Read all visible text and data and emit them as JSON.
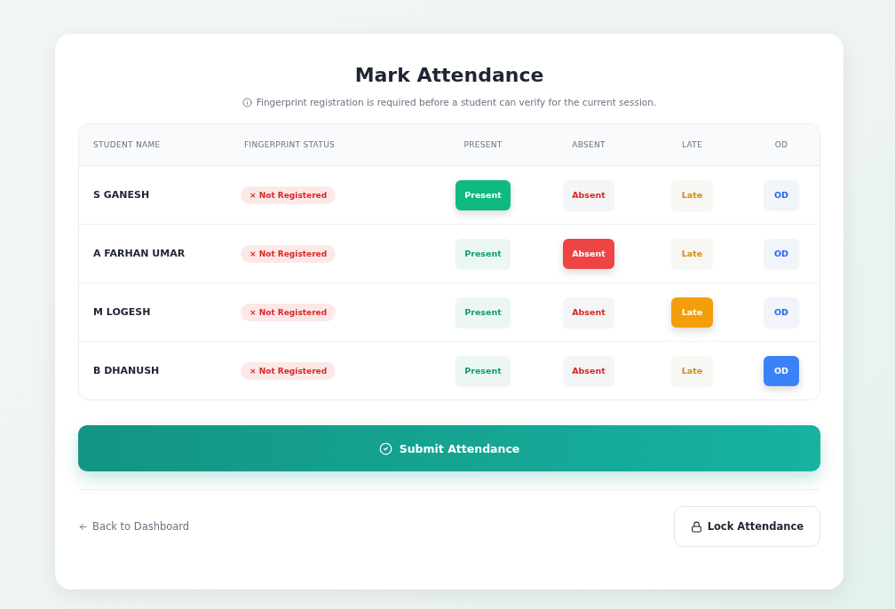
{
  "title": "Mark Attendance",
  "notice": "Fingerprint registration is required before a student can verify for the current session.",
  "table": {
    "columns": [
      "STUDENT NAME",
      "FINGERPRINT STATUS",
      "PRESENT",
      "ABSENT",
      "LATE",
      "OD"
    ],
    "rows": [
      {
        "name": "S GANESH",
        "fingerprint": {
          "mark": "×",
          "label": "Not Registered"
        },
        "options": [
          {
            "kind": "present",
            "label": "Present",
            "selected": true
          },
          {
            "kind": "absent",
            "label": "Absent",
            "selected": false
          },
          {
            "kind": "late",
            "label": "Late",
            "selected": false
          },
          {
            "kind": "od",
            "label": "OD",
            "selected": false
          }
        ]
      },
      {
        "name": "A FARHAN UMAR",
        "fingerprint": {
          "mark": "×",
          "label": "Not Registered"
        },
        "options": [
          {
            "kind": "present",
            "label": "Present",
            "selected": false
          },
          {
            "kind": "absent",
            "label": "Absent",
            "selected": true
          },
          {
            "kind": "late",
            "label": "Late",
            "selected": false
          },
          {
            "kind": "od",
            "label": "OD",
            "selected": false
          }
        ]
      },
      {
        "name": "M LOGESH",
        "fingerprint": {
          "mark": "×",
          "label": "Not Registered"
        },
        "options": [
          {
            "kind": "present",
            "label": "Present",
            "selected": false
          },
          {
            "kind": "absent",
            "label": "Absent",
            "selected": false
          },
          {
            "kind": "late",
            "label": "Late",
            "selected": true
          },
          {
            "kind": "od",
            "label": "OD",
            "selected": false
          }
        ]
      },
      {
        "name": "B DHANUSH",
        "fingerprint": {
          "mark": "×",
          "label": "Not Registered"
        },
        "options": [
          {
            "kind": "present",
            "label": "Present",
            "selected": false
          },
          {
            "kind": "absent",
            "label": "Absent",
            "selected": false
          },
          {
            "kind": "late",
            "label": "Late",
            "selected": false
          },
          {
            "kind": "od",
            "label": "OD",
            "selected": true
          }
        ]
      }
    ]
  },
  "submit_button": "Submit Attendance",
  "back_link": "Back to Dashboard",
  "lock_button": "Lock Attendance"
}
